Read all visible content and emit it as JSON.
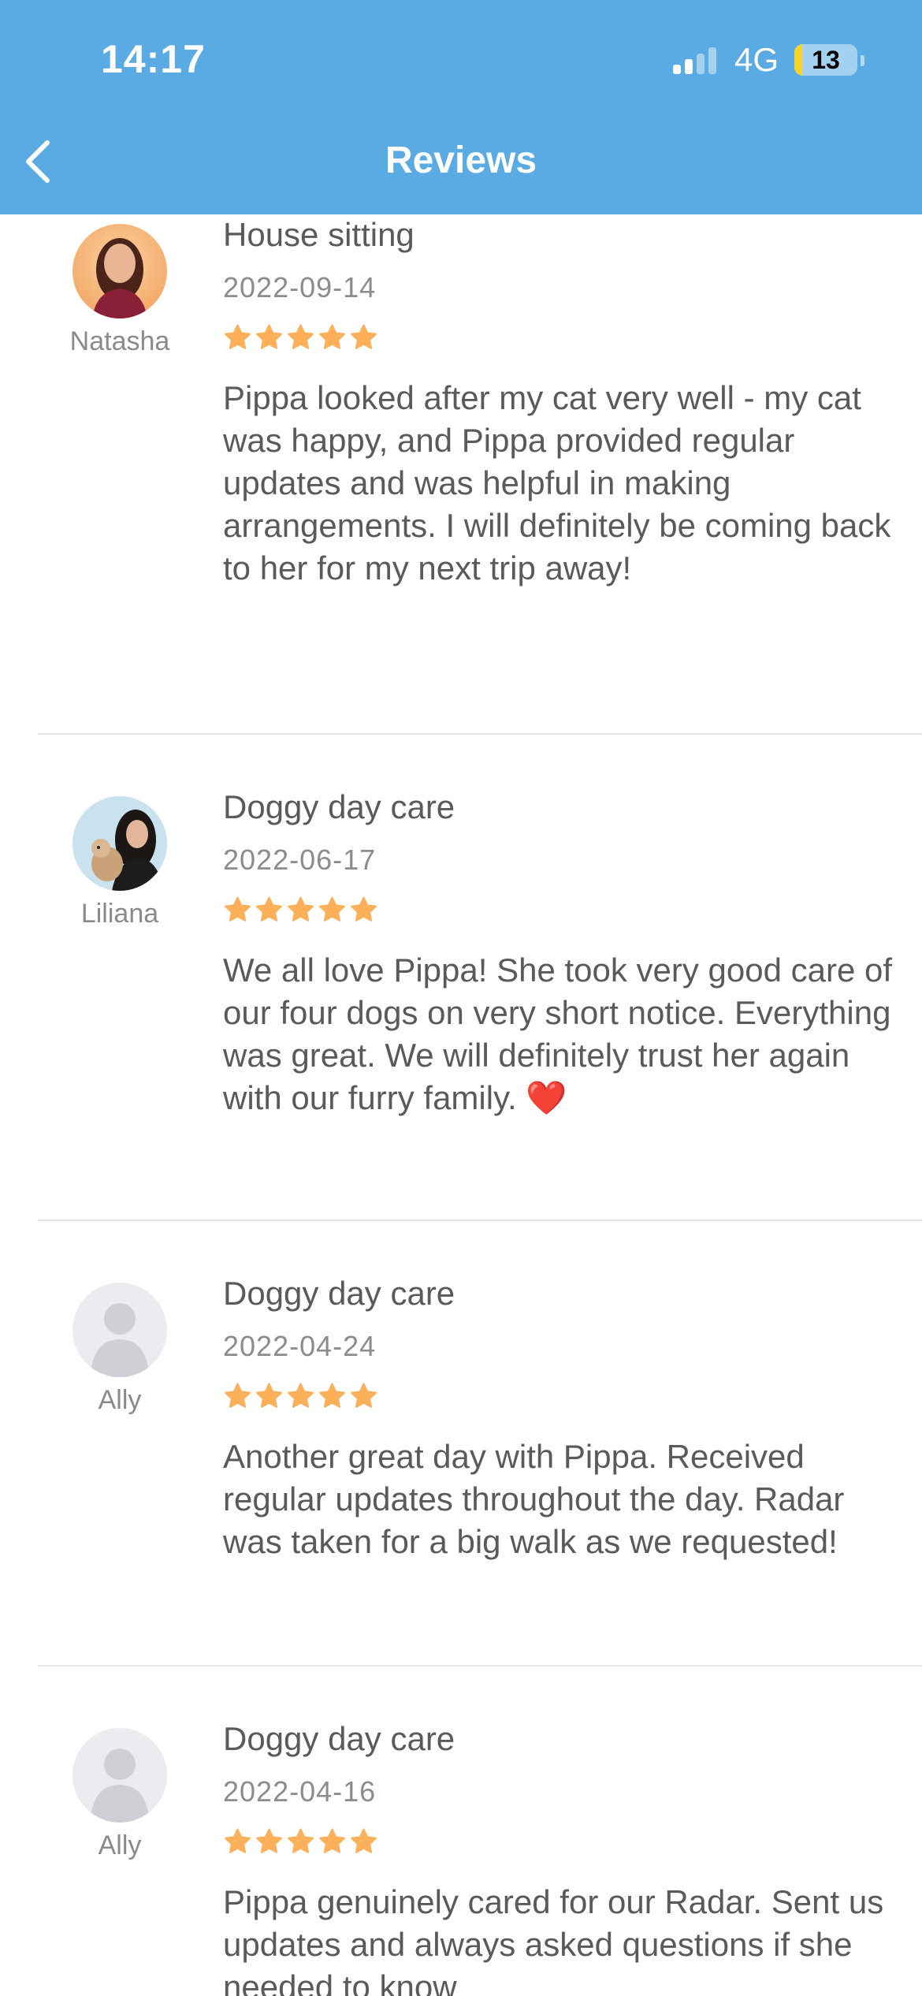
{
  "status_bar": {
    "time": "14:17",
    "network": "4G",
    "battery_level": "13",
    "battery_fraction": 0.13,
    "signal_icon": "signal-bars-icon"
  },
  "nav": {
    "title": "Reviews",
    "back_icon": "chevron-left-icon"
  },
  "colors": {
    "header": "#5aabe3",
    "star": "#fdb05a",
    "text": "#5a5a5a",
    "muted": "#8c8c8c",
    "divider": "#e6e6e6"
  },
  "reviews": [
    {
      "reviewer": "Natasha",
      "service": "House sitting",
      "date": "2022-09-14",
      "rating": 5,
      "comment": "Pippa looked after my cat very well - my cat was happy, and Pippa provided regular updates and was helpful in making arrangements. I will definitely be coming back to her for my next trip away!"
    },
    {
      "reviewer": "Liliana",
      "service": "Doggy day care",
      "date": "2022-06-17",
      "rating": 5,
      "comment": "We all love Pippa! She took very good care of our four dogs on very short notice. Everything was great. We will definitely trust her again with our furry family. ❤️"
    },
    {
      "reviewer": "Ally",
      "service": "Doggy day care",
      "date": "2022-04-24",
      "rating": 5,
      "comment": "Another great day with Pippa. Received regular updates throughout the day. Radar was taken for a big walk as we requested!"
    },
    {
      "reviewer": "Ally",
      "service": "Doggy day care",
      "date": "2022-04-16",
      "rating": 5,
      "comment": "Pippa genuinely cared for our Radar. Sent us updates and always asked questions if she needed to know"
    }
  ]
}
